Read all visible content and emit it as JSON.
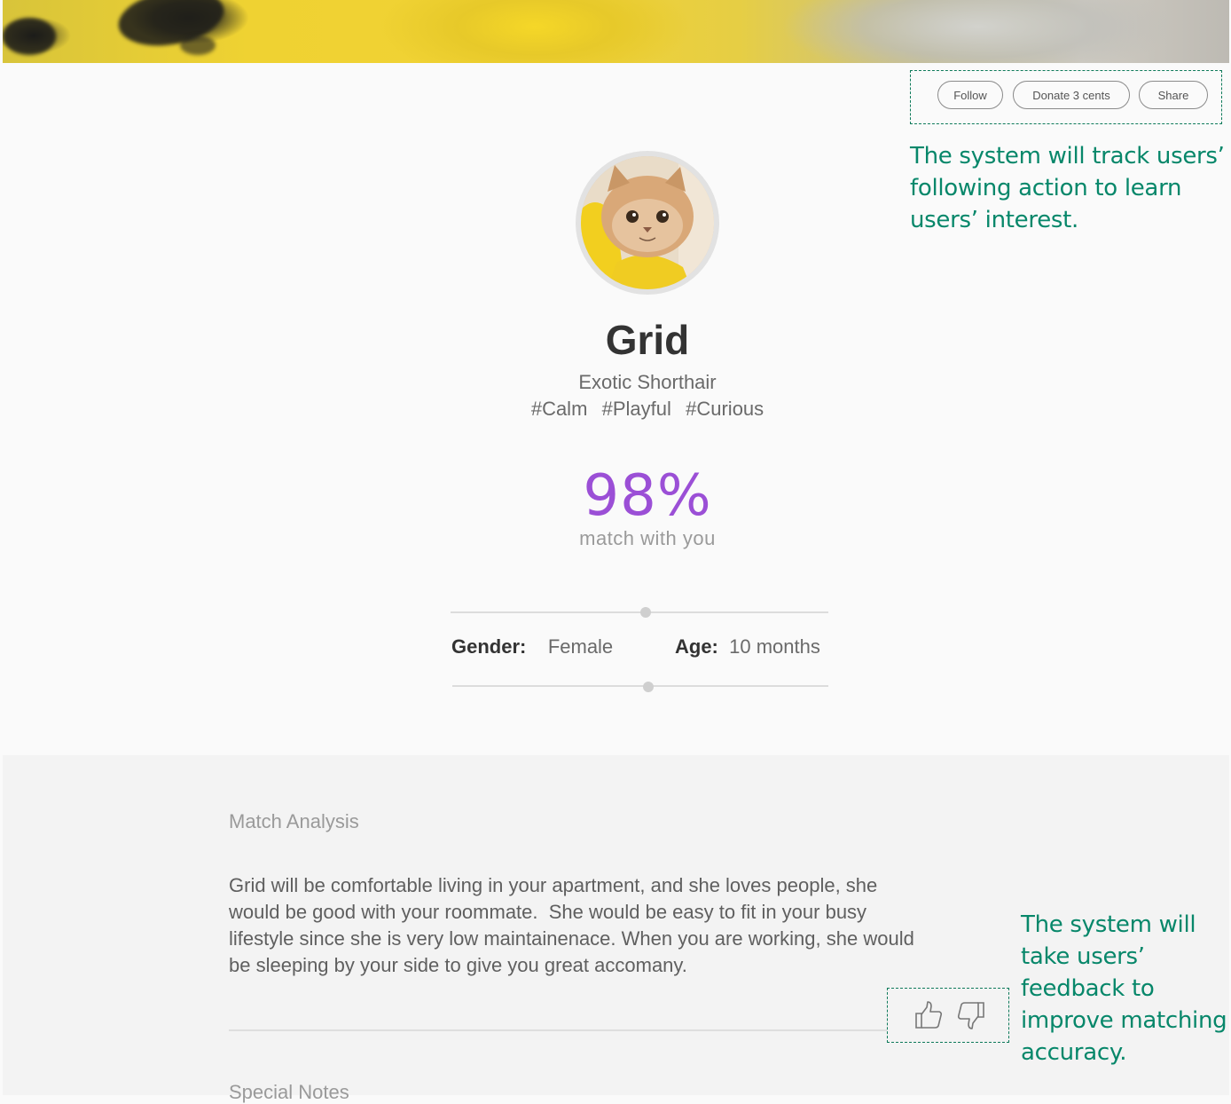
{
  "actions": {
    "follow": "Follow",
    "donate": "Donate 3 cents",
    "share": "Share"
  },
  "annotations": {
    "follow_note": [
      "The system will track users’",
      "following action to learn",
      "users’ interest."
    ],
    "feedback_note": [
      "The system will",
      "take users’",
      "feedback to",
      "improve matching",
      "accuracy."
    ]
  },
  "pet": {
    "name": "Grid",
    "breed": "Exotic Shorthair",
    "tags": "#Calm  #Playful  #Curious",
    "match_percent": "98%",
    "match_label": "match with you",
    "gender_label": "Gender:",
    "gender": "Female",
    "age_label": "Age:",
    "age": "10 months"
  },
  "analysis": {
    "title": "Match Analysis",
    "lines": [
      "Grid will be comfortable living in your apartment, and she loves people, she",
      "would be good with your roommate.  She would be easy to fit in your busy",
      "lifestyle since she is very low maintainenace. When you are working, she would",
      "be sleeping by your side to give you great accomany."
    ],
    "next_section": "Special Notes"
  },
  "icons": {
    "thumbs_up": "thumbs-up-icon",
    "thumbs_down": "thumbs-down-icon"
  },
  "colors": {
    "accent_purple": "#9b4fd6",
    "annotation_green": "#07876a"
  }
}
